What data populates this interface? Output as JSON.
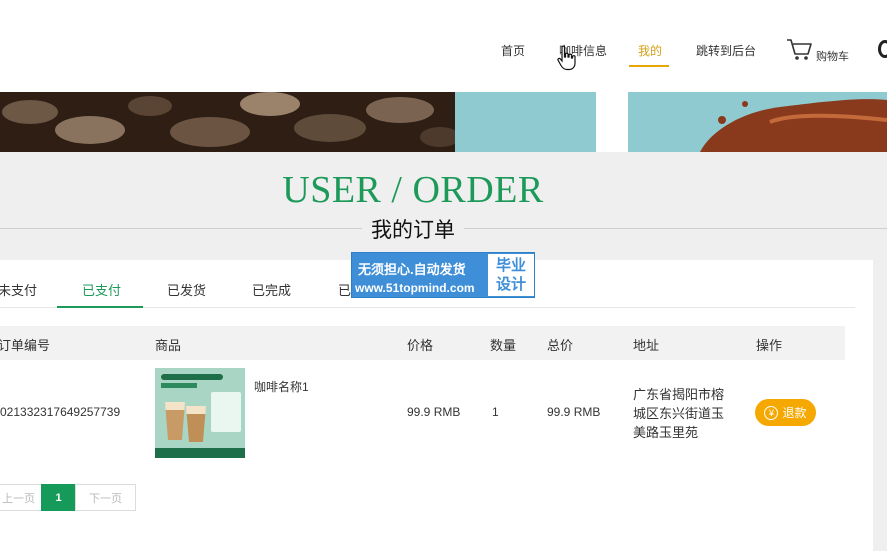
{
  "nav": {
    "items": [
      "首页",
      "咖啡信息",
      "我的",
      "跳转到后台"
    ],
    "active_index": 2,
    "cart_label": "购物车"
  },
  "heading": {
    "title_en": "USER / ORDER",
    "title_cn": "我的订单"
  },
  "tabs": {
    "items": [
      "未支付",
      "已支付",
      "已发货",
      "已完成",
      "已"
    ],
    "active_index": 1
  },
  "table": {
    "columns": [
      "订单编号",
      "商品",
      "价格",
      "数量",
      "总价",
      "地址",
      "操作"
    ],
    "rows": [
      {
        "order_no": "021332317649257739",
        "product_name": "咖啡名称1",
        "price": "99.9 RMB",
        "quantity": "1",
        "total": "99.9 RMB",
        "address": "广东省揭阳市榕城区东兴街道玉美路玉里苑",
        "action": "退款",
        "action_icon": "yen-icon"
      }
    ]
  },
  "pagination": {
    "prev": "上一页",
    "current": "1",
    "next": "下一页"
  },
  "watermark": {
    "line1": "无须担心.自动发货",
    "line2": "www.51topmind.com",
    "box_line1": "毕业",
    "box_line2": "设计"
  },
  "colors": {
    "brand_green": "#1d9a5a",
    "nav_active": "#d4a017",
    "refund_button": "#f5a800"
  }
}
